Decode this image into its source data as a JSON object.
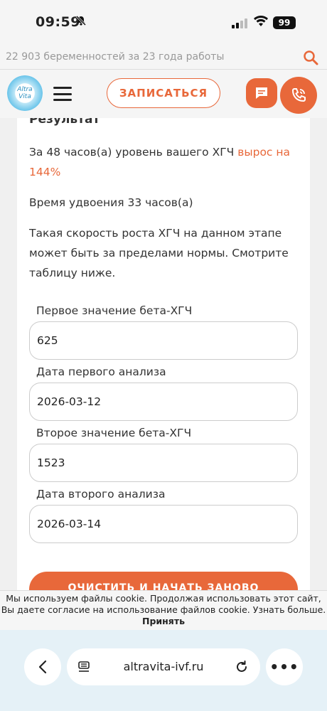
{
  "status_bar": {
    "time": "09:59",
    "battery": "99"
  },
  "site": {
    "tagline": "22 903 беременностей за 23 года работы",
    "logo_text_top": "Altra",
    "logo_text_bottom": "Vita",
    "signup_label": "ЗАПИСАТЬСЯ"
  },
  "result": {
    "title": "Результат",
    "line1_prefix": "За 48 часов(а) уровень вашего ХГЧ ",
    "line1_accent": "вырос на 144%",
    "line2": "Время удвоения 33 часов(а)",
    "line3": "Такая скорость роста ХГЧ на данном этапе может быть за пределами нормы. Смотрите таблицу ниже."
  },
  "form": {
    "first_value_label": "Первое значение бета-ХГЧ",
    "first_value": "625",
    "first_date_label": "Дата первого анализа",
    "first_date": "2026-03-12",
    "second_value_label": "Второе значение бета-ХГЧ",
    "second_value": "1523",
    "second_date_label": "Дата второго анализа",
    "second_date": "2026-03-14",
    "clear_button": "ОЧИСТИТЬ И НАЧАТЬ ЗАНОВО"
  },
  "cookie": {
    "text": "Мы используем файлы cookie. Продолжая использовать этот сайт, Вы даете согласие на использование файлов cookie. Узнать больше.",
    "accept": "Принять"
  },
  "browser": {
    "domain": "altravita-ivf.ru"
  },
  "colors": {
    "accent": "#e8683a",
    "browser_bar": "#e5f1f7"
  }
}
